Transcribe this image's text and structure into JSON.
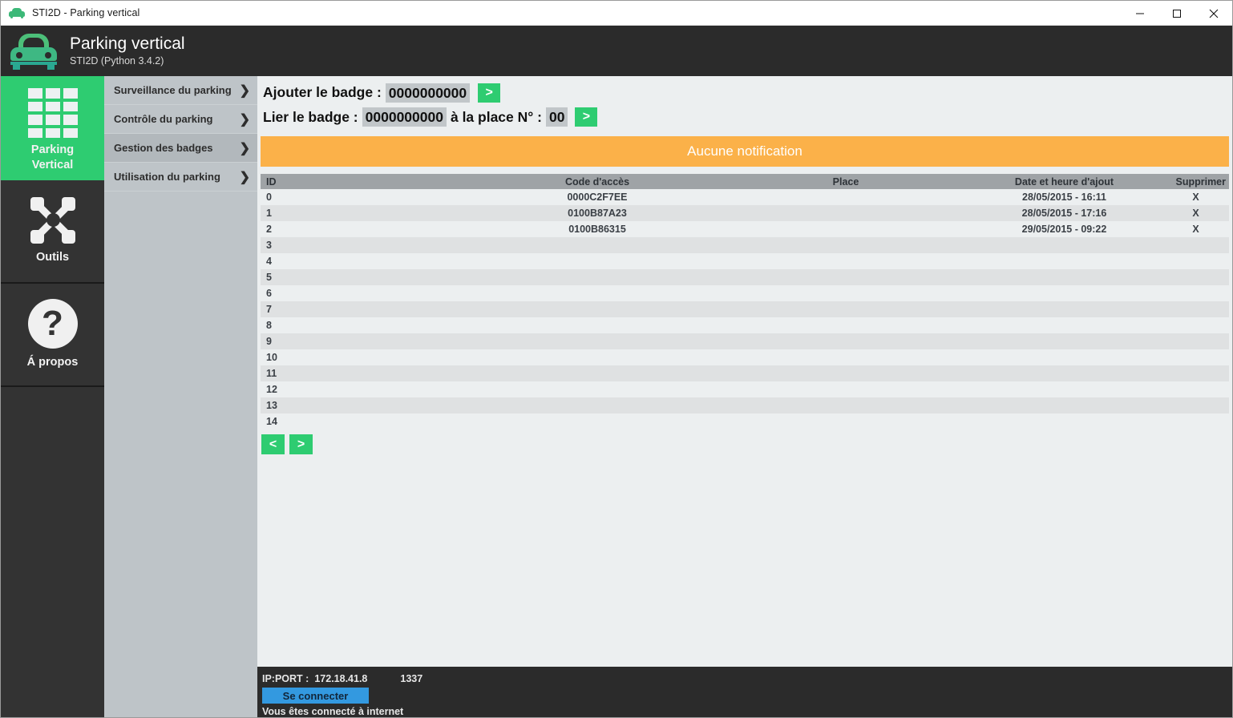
{
  "window": {
    "title": "STI2D - Parking vertical",
    "icon": "car-icon",
    "minimize": "—",
    "maximize": "□",
    "close": "✕"
  },
  "header": {
    "title": "Parking vertical",
    "subtitle": "STI2D (Python 3.4.2)",
    "icon": "car-icon"
  },
  "rail": {
    "items": [
      {
        "label_line1": "Parking",
        "label_line2": "Vertical",
        "icon": "grid-icon",
        "active": true
      },
      {
        "label_line1": "Outils",
        "label_line2": "",
        "icon": "tools-icon",
        "active": false
      },
      {
        "label_line1": "Á propos",
        "label_line2": "",
        "icon": "question-icon",
        "active": false
      }
    ]
  },
  "menu": {
    "items": [
      {
        "label": "Surveillance du parking",
        "chevron": "❯",
        "selected": false
      },
      {
        "label": "Contrôle du parking",
        "chevron": "❯",
        "selected": false
      },
      {
        "label": "Gestion des badges",
        "chevron": "❯",
        "selected": true
      },
      {
        "label": "Utilisation du parking",
        "chevron": "❯",
        "selected": false
      }
    ]
  },
  "form": {
    "add_label": "Ajouter le badge :",
    "add_value": "0000000000",
    "add_submit": ">",
    "link_label": "Lier le badge :",
    "link_value": "0000000000",
    "link_mid_label": "à la place N° :",
    "link_place_value": "00",
    "link_submit": ">"
  },
  "notification": {
    "text": "Aucune notification",
    "color": "#fbb149"
  },
  "table": {
    "headers": {
      "id": "ID",
      "code": "Code d'accès",
      "place": "Place",
      "date": "Date et heure d'ajout",
      "delete": "Supprimer"
    },
    "rows": [
      {
        "id": "0",
        "code": "0000C2F7EE",
        "place": "",
        "date": "28/05/2015 - 16:11",
        "delete": "X"
      },
      {
        "id": "1",
        "code": "0100B87A23",
        "place": "",
        "date": "28/05/2015 - 17:16",
        "delete": "X"
      },
      {
        "id": "2",
        "code": "0100B86315",
        "place": "",
        "date": "29/05/2015 - 09:22",
        "delete": "X"
      },
      {
        "id": "3",
        "code": "",
        "place": "",
        "date": "",
        "delete": ""
      },
      {
        "id": "4",
        "code": "",
        "place": "",
        "date": "",
        "delete": ""
      },
      {
        "id": "5",
        "code": "",
        "place": "",
        "date": "",
        "delete": ""
      },
      {
        "id": "6",
        "code": "",
        "place": "",
        "date": "",
        "delete": ""
      },
      {
        "id": "7",
        "code": "",
        "place": "",
        "date": "",
        "delete": ""
      },
      {
        "id": "8",
        "code": "",
        "place": "",
        "date": "",
        "delete": ""
      },
      {
        "id": "9",
        "code": "",
        "place": "",
        "date": "",
        "delete": ""
      },
      {
        "id": "10",
        "code": "",
        "place": "",
        "date": "",
        "delete": ""
      },
      {
        "id": "11",
        "code": "",
        "place": "",
        "date": "",
        "delete": ""
      },
      {
        "id": "12",
        "code": "",
        "place": "",
        "date": "",
        "delete": ""
      },
      {
        "id": "13",
        "code": "",
        "place": "",
        "date": "",
        "delete": ""
      },
      {
        "id": "14",
        "code": "",
        "place": "",
        "date": "",
        "delete": ""
      }
    ]
  },
  "pager": {
    "prev": "<",
    "next": ">"
  },
  "status": {
    "ip_port_label": "IP:PORT :",
    "ip": "172.18.41.8",
    "port": "1337",
    "connect_label": "Se connecter",
    "connection_text": "Vous êtes connecté à internet"
  },
  "colors": {
    "accent_green": "#2ecc71",
    "header_dark": "#2b2b2b",
    "notification_orange": "#fbb149",
    "connect_blue": "#3399e0"
  }
}
